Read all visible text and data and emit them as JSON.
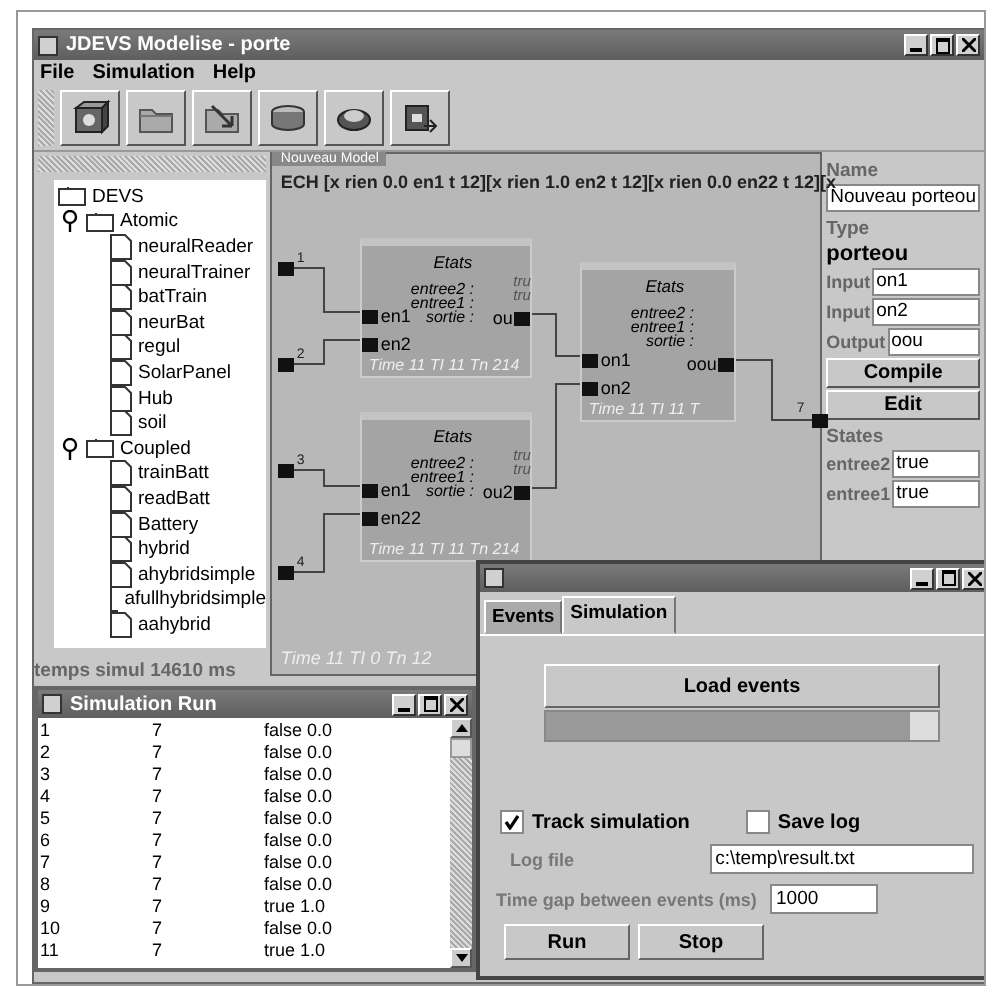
{
  "window": {
    "title": "JDEVS Modelise - porte"
  },
  "menu": [
    "File",
    "Simulation",
    "Help"
  ],
  "tree": {
    "label": "DEVS",
    "children": [
      {
        "label": "Atomic",
        "expanded": true,
        "children": [
          {
            "label": "neuralReader"
          },
          {
            "label": "neuralTrainer"
          },
          {
            "label": "batTrain"
          },
          {
            "label": "neurBat"
          },
          {
            "label": "regul"
          },
          {
            "label": "SolarPanel"
          },
          {
            "label": "Hub"
          },
          {
            "label": "soil"
          }
        ]
      },
      {
        "label": "Coupled",
        "expanded": true,
        "children": [
          {
            "label": "trainBatt"
          },
          {
            "label": "readBatt"
          },
          {
            "label": "Battery"
          },
          {
            "label": "hybrid"
          },
          {
            "label": "ahybridsimple"
          },
          {
            "label": "afullhybridsimple"
          },
          {
            "label": "aahybrid"
          }
        ]
      }
    ]
  },
  "status": "temps simul 14610 ms",
  "diagram": {
    "title": "Nouveau Model",
    "header": "ECH [x rien 0.0 en1 t 12][x rien 1.0 en2 t 12][x rien 0.0 en22 t 12][x",
    "inputs": [
      "1",
      "2",
      "3",
      "4"
    ],
    "output": "7",
    "footer": "Time 11 TI 0 Tn 12",
    "blocks": [
      {
        "title": "Etats",
        "states": [
          "entree2 :",
          "entree1 :",
          "sortie :"
        ],
        "inputs": [
          "en1",
          "en2"
        ],
        "output": "ou",
        "values": [
          "tru",
          "tru"
        ],
        "time": "Time 11 TI 11 Tn 214"
      },
      {
        "title": "Etats",
        "states": [
          "entree2 :",
          "entree1 :",
          "sortie :"
        ],
        "inputs": [
          "en1",
          "en22"
        ],
        "output": "ou2",
        "values": [
          "tru",
          "tru"
        ],
        "time": "Time 11 TI 11 Tn 214"
      },
      {
        "title": "Etats",
        "states": [
          "entree2 :",
          "entree1 :",
          "sortie :"
        ],
        "inputs": [
          "on1",
          "on2"
        ],
        "output": "oou",
        "time": "Time 11 TI 11 T"
      }
    ]
  },
  "properties": [
    {
      "kind": "heading",
      "text": "Name"
    },
    {
      "kind": "field",
      "value": "Nouveau porteou"
    },
    {
      "kind": "heading",
      "text": "Type"
    },
    {
      "kind": "type",
      "text": "porteou"
    },
    {
      "kind": "labeled",
      "label": "Input",
      "value": "on1"
    },
    {
      "kind": "labeled",
      "label": "Input",
      "value": "on2"
    },
    {
      "kind": "labeled",
      "label": "Output",
      "value": "oou"
    },
    {
      "kind": "button",
      "text": "Compile"
    },
    {
      "kind": "button",
      "text": "Edit"
    },
    {
      "kind": "heading",
      "text": "States"
    },
    {
      "kind": "labeled",
      "label": "entree2",
      "value": "true"
    },
    {
      "kind": "labeled",
      "label": "entree1",
      "value": "true"
    }
  ],
  "run_window": {
    "title": "Simulation Run",
    "rows": [
      [
        "1",
        "7",
        "false 0.0"
      ],
      [
        "2",
        "7",
        "false 0.0"
      ],
      [
        "3",
        "7",
        "false 0.0"
      ],
      [
        "4",
        "7",
        "false 0.0"
      ],
      [
        "5",
        "7",
        "false 0.0"
      ],
      [
        "6",
        "7",
        "false 0.0"
      ],
      [
        "7",
        "7",
        "false 0.0"
      ],
      [
        "8",
        "7",
        "false 0.0"
      ],
      [
        "9",
        "7",
        "true 1.0"
      ],
      [
        "10",
        "7",
        "false 0.0"
      ],
      [
        "11",
        "7",
        "true 1.0"
      ]
    ]
  },
  "dialog": {
    "tabs": [
      {
        "label": "Events",
        "selected": false
      },
      {
        "label": "Simulation",
        "selected": true
      }
    ],
    "load_button": "Load events",
    "progress": {
      "level": 0.93
    },
    "options": [
      {
        "label": "Track simulation",
        "checked": true
      },
      {
        "label": "Save log",
        "checked": false
      }
    ],
    "fields": [
      {
        "label": "Log file",
        "value": "c:\\temp\\result.txt",
        "disabled": true
      },
      {
        "label": "Time gap between events (ms)",
        "value": "1000",
        "disabled": true
      }
    ],
    "buttons": [
      "Run",
      "Stop"
    ]
  }
}
